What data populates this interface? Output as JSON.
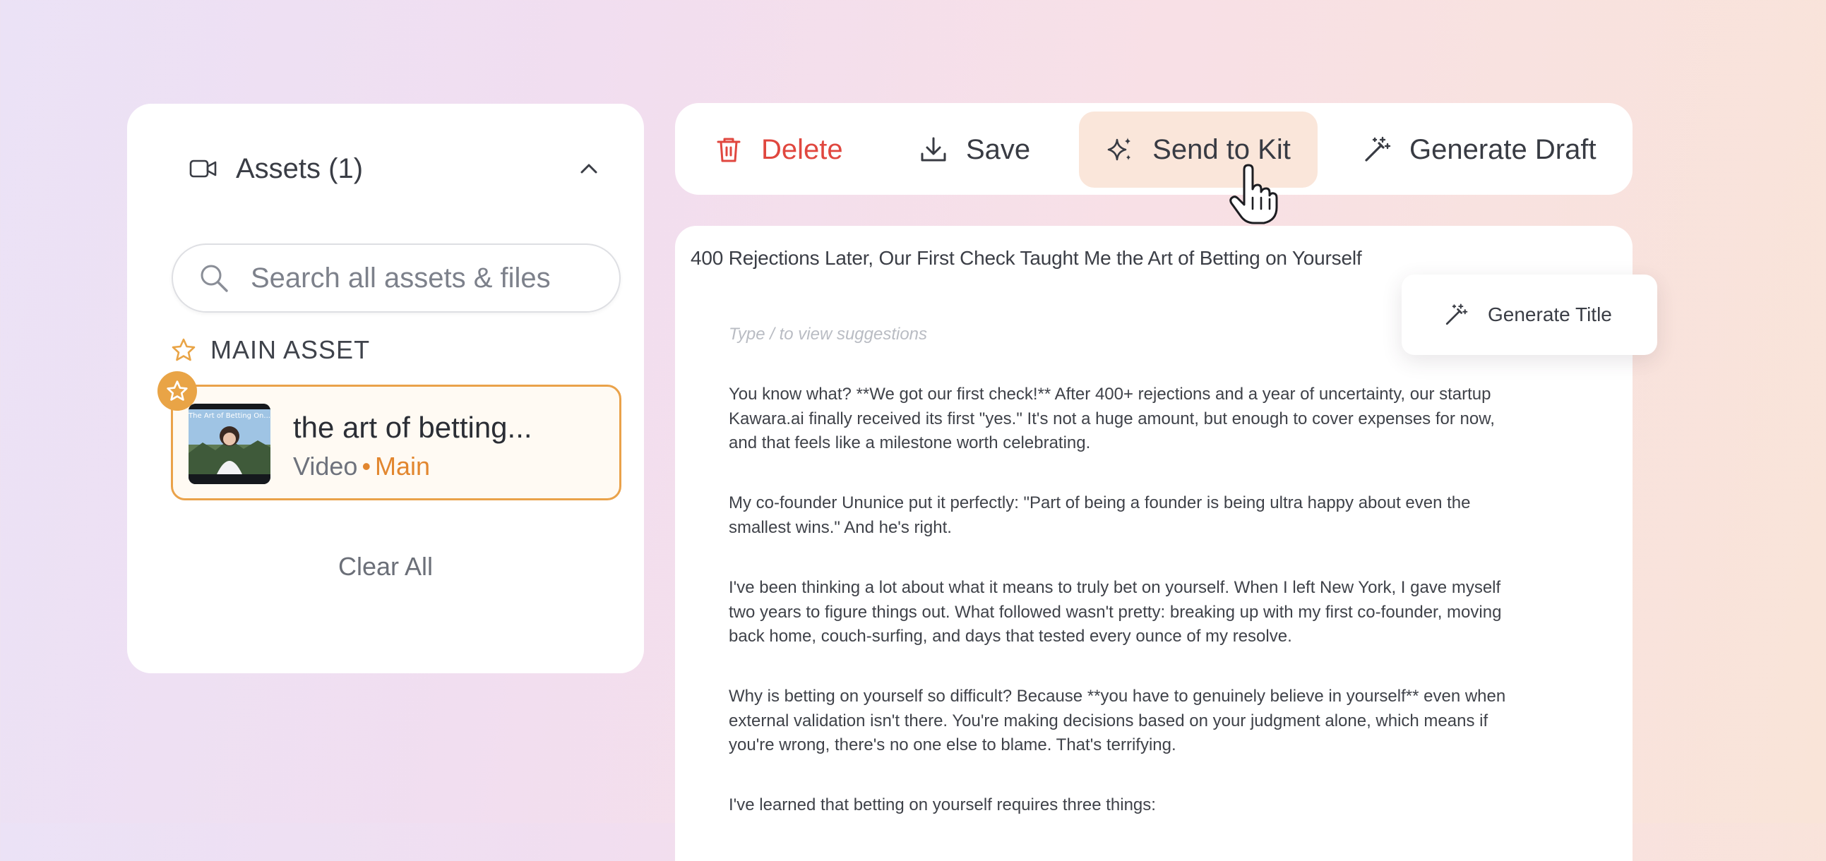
{
  "assets": {
    "header_title": "Assets (1)",
    "search_placeholder": "Search all assets & files",
    "main_asset_label": "MAIN ASSET",
    "card": {
      "name": "the art of betting...",
      "type": "Video",
      "tag": "Main",
      "thumbnail_caption": "The Art of Betting On..."
    },
    "clear_all": "Clear All"
  },
  "toolbar": {
    "delete": "Delete",
    "save": "Save",
    "send_to_kit": "Send to Kit",
    "generate_draft": "Generate Draft"
  },
  "editor": {
    "title": "400 Rejections Later, Our First Check Taught Me the Art of Betting on Yourself",
    "hint": "Type / to view suggestions",
    "paragraphs": [
      "You know what? **We got our first check!** After 400+ rejections and a year of uncertainty, our startup Kawara.ai finally received its first \"yes.\" It's not a huge amount, but enough to cover expenses for now, and that feels like a milestone worth celebrating.",
      "My co-founder Ununice put it perfectly: \"Part of being a founder is being ultra happy about even the smallest wins.\" And he's right.",
      "I've been thinking a lot about what it means to truly bet on yourself. When I left New York, I gave myself two years to figure things out. What followed wasn't pretty: breaking up with my first co-founder, moving back home, couch-surfing, and days that tested every ounce of my resolve.",
      "Why is betting on yourself so difficult? Because **you have to genuinely believe in yourself** even when external validation isn't there. You're making decisions based on your judgment alone, which means if you're wrong, there's no one else to blame. That's terrifying.",
      "I've learned that betting on yourself requires three things:"
    ]
  },
  "popover": {
    "generate_title": "Generate Title"
  },
  "colors": {
    "accent": "#e9a446",
    "danger": "#e0473f",
    "highlight": "#fae6da"
  }
}
